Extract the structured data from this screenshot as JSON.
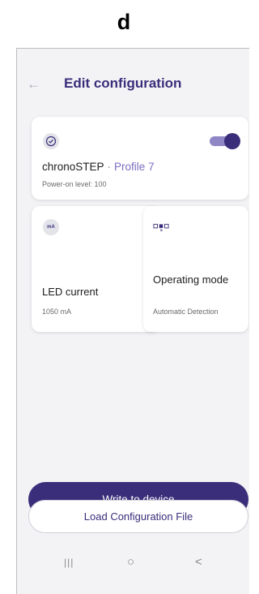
{
  "figure_label": "d",
  "header": {
    "back_icon": "back-arrow-icon",
    "title": "Edit configuration"
  },
  "profile_card": {
    "icon": "clock-icon",
    "toggle_on": true,
    "product": "chronoSTEP",
    "separator": "·",
    "profile": "Profile 7",
    "power_on": "Power-on level: 100"
  },
  "led_card": {
    "icon": "milliamp-icon",
    "icon_text": "mA",
    "label": "LED current",
    "value": "1050 mA"
  },
  "mode_card": {
    "icon": "operating-mode-icon",
    "label": "Operating mode",
    "value": "Automatic Detection"
  },
  "actions": {
    "write_label": "Write to device",
    "load_label": "Load Configuration File"
  },
  "navbar": {
    "recent": "|||",
    "home": "○",
    "back": "<"
  },
  "colors": {
    "accent": "#3a2e7a",
    "accent_light": "#7a6fbf",
    "background": "#f3f3f6"
  }
}
